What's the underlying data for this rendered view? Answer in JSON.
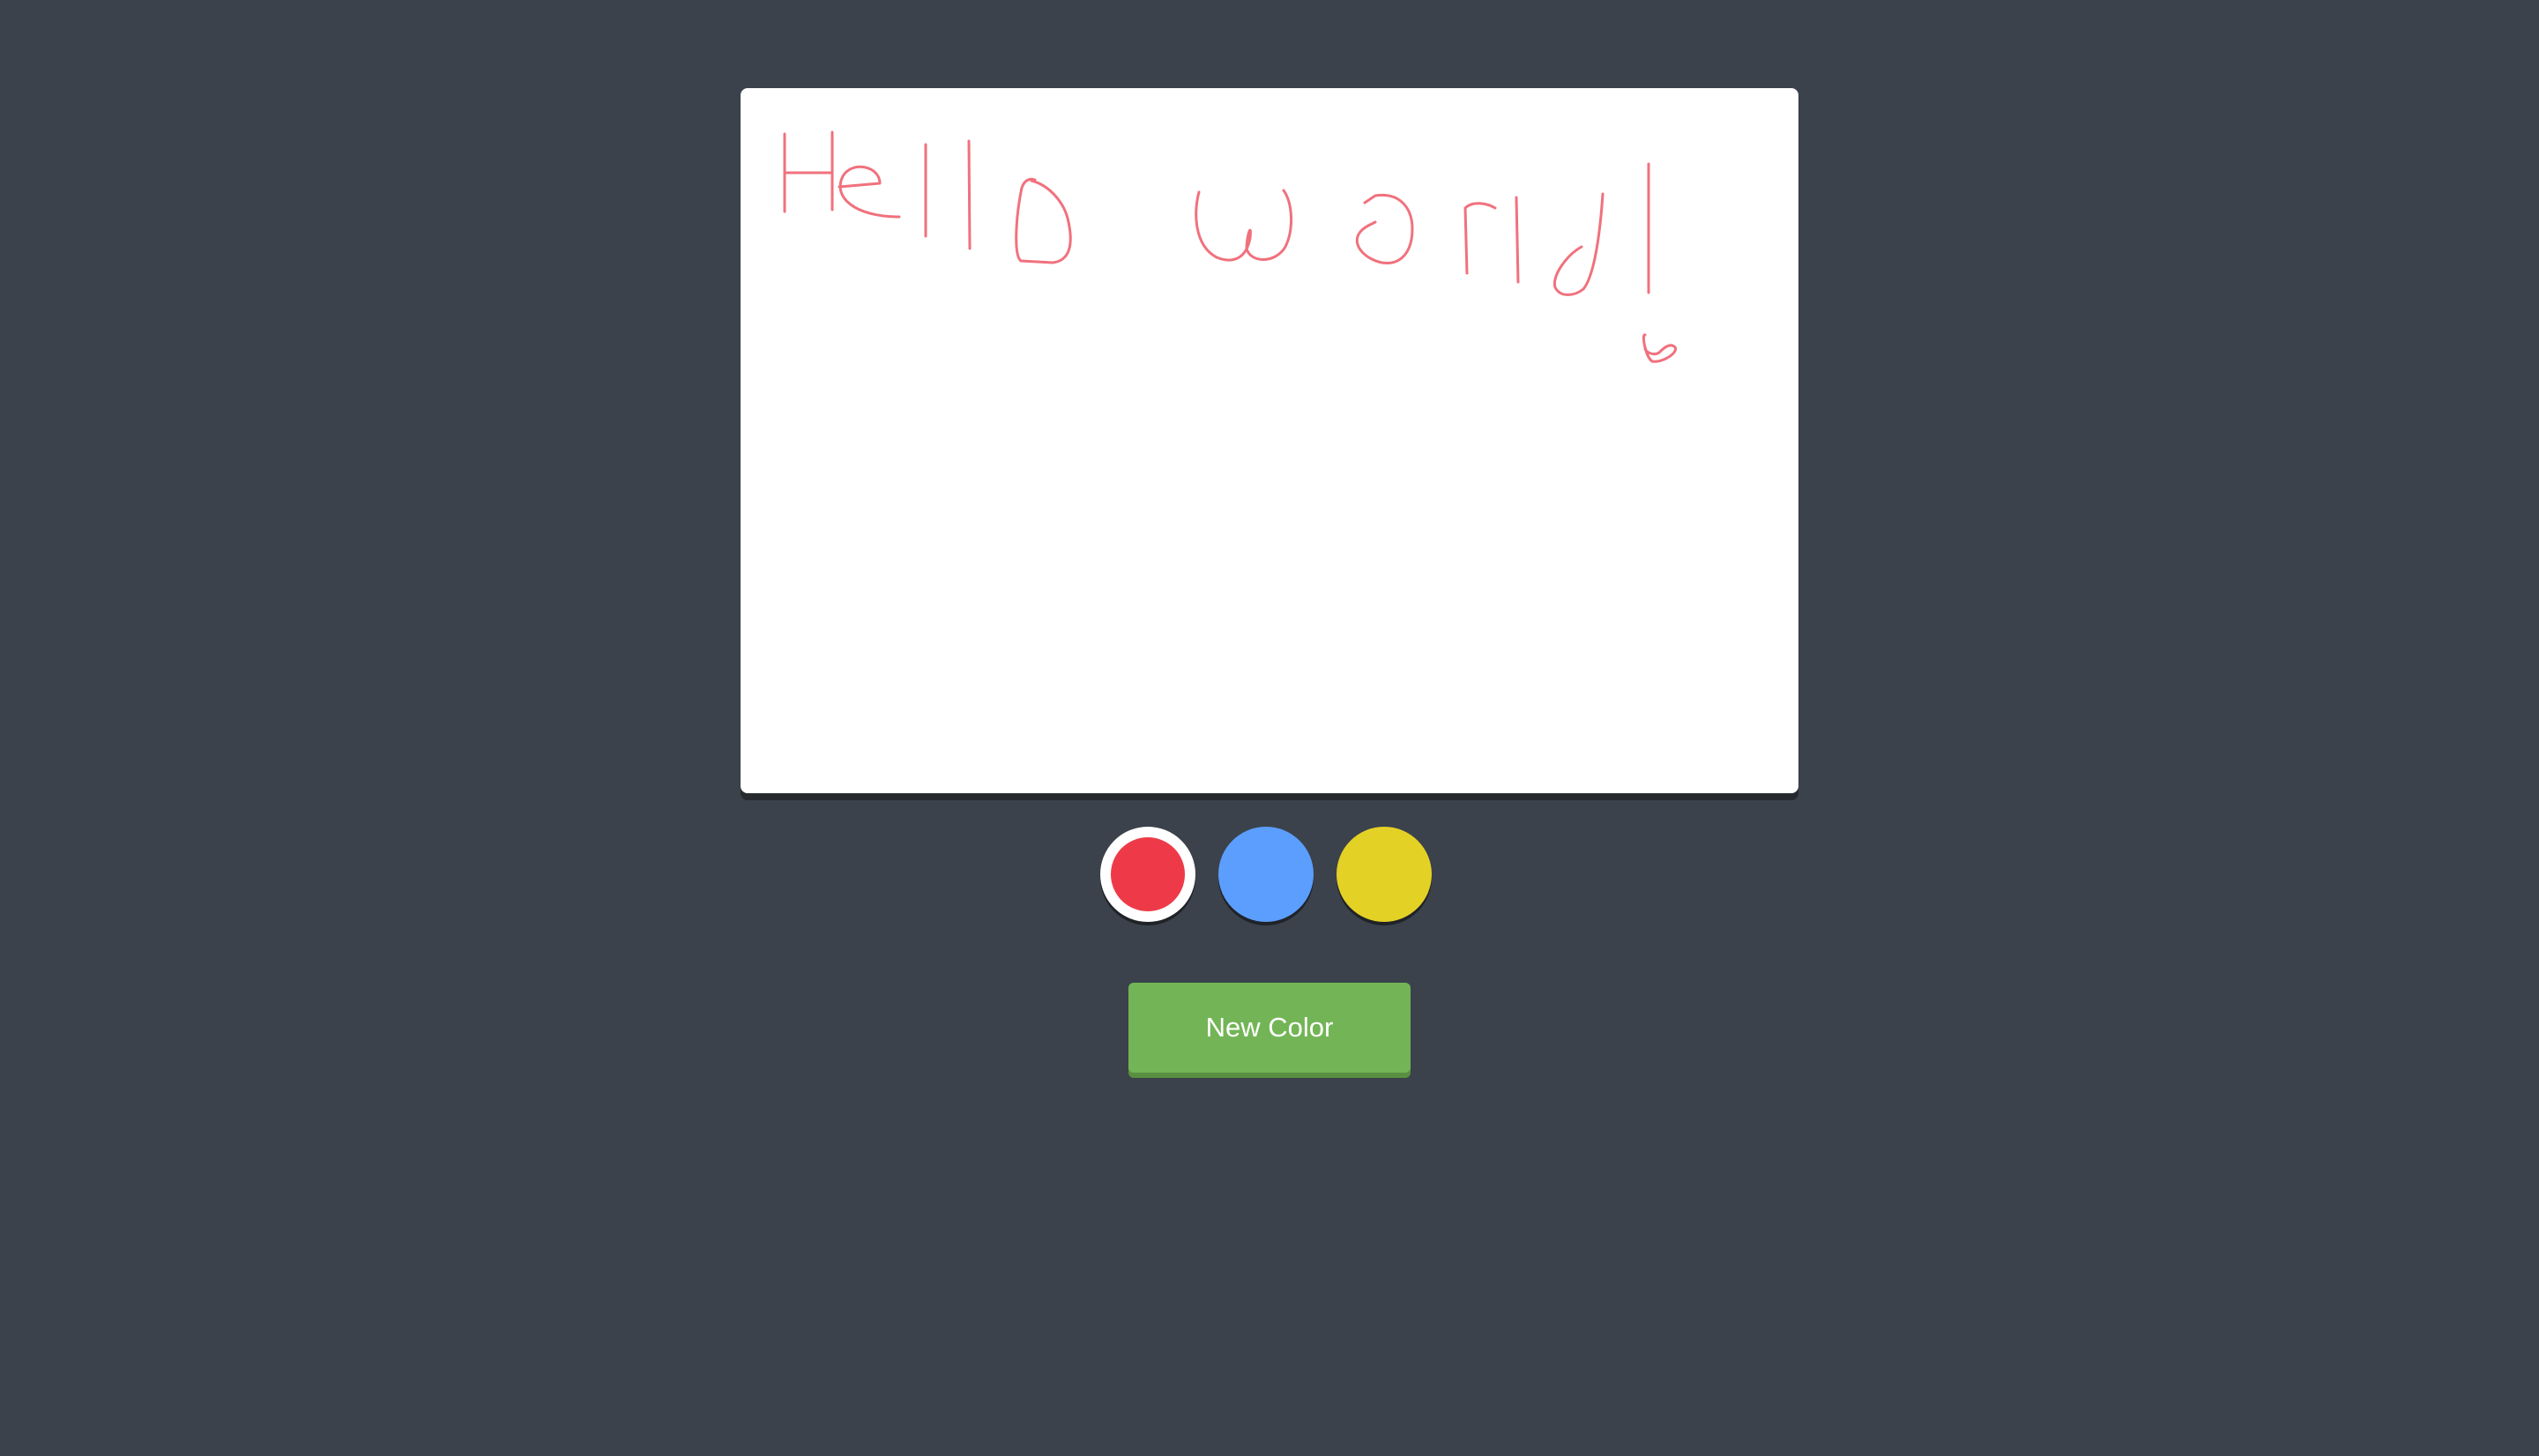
{
  "canvas": {
    "stroke_color": "#f0717d"
  },
  "palette": {
    "colors": [
      {
        "name": "red",
        "hex": "#ee3a48",
        "selected": true
      },
      {
        "name": "blue",
        "hex": "#5c9efd",
        "selected": false
      },
      {
        "name": "yellow",
        "hex": "#e4d126",
        "selected": false
      }
    ]
  },
  "new_color_button": {
    "label": "New Color"
  }
}
